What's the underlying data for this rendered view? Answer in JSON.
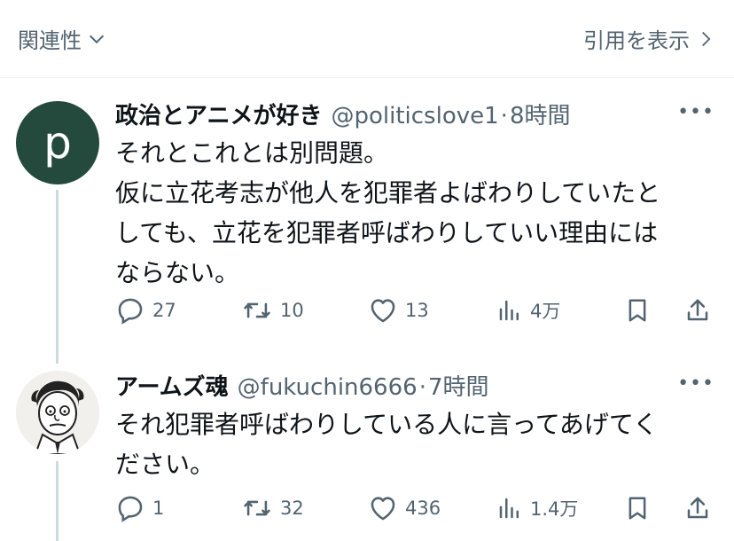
{
  "topbar": {
    "related_label": "関連性",
    "quote_label": "引用を表示"
  },
  "tweets": [
    {
      "avatar_letter": "p",
      "name": "政治とアニメが好き",
      "handle": "@politicslove1",
      "separator": "·",
      "time": "8時間",
      "text": "それとこれとは別問題。\n仮に立花考志が他人を犯罪者よばわりしていたと\nしても、立花を犯罪者呼ばわりしていい理由には\nならない。",
      "replies": "27",
      "retweets": "10",
      "likes": "13",
      "views": "4万"
    },
    {
      "name": "アームズ魂",
      "handle": "@fukuchin6666",
      "separator": "·",
      "time": "7時間",
      "text": "それ犯罪者呼ばわりしている人に言ってあげてく\nださい。",
      "replies": "1",
      "retweets": "32",
      "likes": "436",
      "views": "1.4万"
    }
  ],
  "icons": {
    "reply": "reply-icon",
    "retweet": "retweet-icon",
    "like": "heart-icon",
    "views": "views-icon",
    "bookmark": "bookmark-icon",
    "share": "share-icon",
    "more": "more-icon",
    "chevron_down": "chevron-down-icon",
    "chevron_right": "chevron-right-icon"
  },
  "colors": {
    "text": "#0f1419",
    "secondary": "#536471",
    "avatar_bg": "#244a3d",
    "thread_line": "#cfd9de"
  }
}
